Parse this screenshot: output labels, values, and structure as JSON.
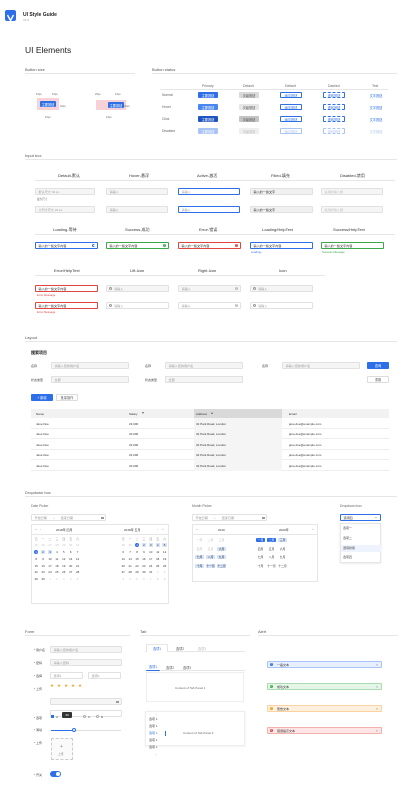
{
  "header": {
    "title": "UI Style Guide",
    "version": "V1.0",
    "page_title": "UI Elements"
  },
  "buttons": {
    "size_title": "Button size",
    "status_title": "Button status",
    "size_annotations": [
      "16px",
      "32px",
      "16px",
      "16px",
      "20px",
      "32px",
      "16px",
      "16px"
    ],
    "size_btn_labels": [
      "主要按钮",
      "主要按钮"
    ],
    "columns": [
      "Primary",
      "Default",
      "Default",
      "Dashed",
      "Text"
    ],
    "rows": [
      "Normal",
      "Hover",
      "Click",
      "Disabled"
    ],
    "primary_label": "主要按钮",
    "default_label": "次级按钮",
    "outline_label": "幽灵按钮",
    "dashed_label": "虚线按钮",
    "text_label": "文字按钮"
  },
  "inputs": {
    "title": "Input box",
    "heads1": [
      "Default-默认",
      "Hover-悬浮",
      "Active-激活",
      "Filled-填充",
      "Disabled-禁用"
    ],
    "placeholder": "请输入",
    "helper_small": "默认尺寸 32 px",
    "helper_small2": "最大尺寸",
    "size_small": "小尺寸尺寸 24 px",
    "filled_text": "输入的一些文字",
    "disabled_text": "禁用的输入框",
    "heads2": [
      "Loading-等待",
      "Success-成功",
      "Error-错误",
      "Loading/HelpText",
      "Success/HelpText"
    ],
    "typed": "输入的一些文字内容",
    "loading_help": "Loading...",
    "success_help": "Success Message",
    "heads3": [
      "Error/HelpText",
      "Lift-Icon",
      "Right-Icon",
      "Icon"
    ],
    "error_msg": "Error Message",
    "icon_placeholder": "请输入"
  },
  "layout": {
    "title": "Layout",
    "form_title": "搜索项目",
    "labels": [
      "名称",
      "名称",
      "名称",
      "状态类型",
      "状态类型"
    ],
    "placeholders": [
      "请输入您的用户名",
      "请输入您的用户名",
      "请输入您的用户名"
    ],
    "select_value": "全部",
    "search_btn": "查询",
    "reset_btn": "重置",
    "add_btn": "+ 新增",
    "batch_btn": "批量操作",
    "table_headers": [
      "Name",
      "Salary",
      "Address",
      "Email"
    ],
    "table_rows": [
      [
        "Jane Doe",
        "23,000",
        "32 Park Road, London",
        "jane.doe@example.com"
      ],
      [
        "Jane Doe",
        "23,000",
        "32 Park Road, London",
        "jane.doe@example.com"
      ],
      [
        "Jane Doe",
        "23,000",
        "32 Park Road, London",
        "jane.doe@example.com"
      ],
      [
        "Jane Doe",
        "23,000",
        "32 Park Road, London",
        "jane.doe@example.com"
      ],
      [
        "Jane Doe",
        "23,000",
        "32 Park Road, London",
        "jane.doe@example.com"
      ]
    ]
  },
  "dropdown": {
    "title": "Dropdown box",
    "date_label": "Date Picker",
    "month_label": "Month Picker",
    "dropdown_label": "Dropdown box",
    "start_ph": "开始日期",
    "end_ph": "结束日期",
    "cal_left_title": "2018年 四月",
    "cal_right_title": "2018年 五月",
    "week": [
      "日",
      "一",
      "二",
      "三",
      "四",
      "五",
      "六"
    ],
    "year_left": "2019",
    "year_right": "2020年",
    "months": [
      "一月",
      "二月",
      "三月",
      "四月",
      "五月",
      "六月",
      "七月",
      "八月",
      "九月",
      "十月",
      "十一月",
      "十二月"
    ],
    "dd_value": "选项四",
    "dd_options": [
      "选项一",
      "选项二",
      "選項狀態",
      "选项四"
    ]
  },
  "form": {
    "title": "Form",
    "labels": [
      "* 用户名",
      "* 密码",
      "* 选择",
      "* 上传",
      "",
      "",
      "* 选项",
      "* 单选",
      "* 滑动",
      "* 上传",
      "* 开关"
    ],
    "username_ph": "请输入您的用户名",
    "password_ph": "请输入密码",
    "select_ph": "选项1",
    "select_ph2": "选项2",
    "checks": [
      "A",
      "B",
      "C",
      "D"
    ],
    "slider_tip": "30",
    "upload_label": "上传"
  },
  "tab": {
    "title": "Tab",
    "tabs1": [
      "选项1",
      "选项2",
      "选项3"
    ],
    "tabs2": [
      "选项1",
      "选项2",
      "选项3"
    ],
    "content1": "Content of Tab Panel 1",
    "content2": "Content of Tab Panel 3",
    "vtabs": [
      "选项 1",
      "选项 1",
      "选项 1",
      "选项 1",
      "选项 1"
    ]
  },
  "alert": {
    "title": "Alert",
    "items": [
      "一般文本",
      "成功文本",
      "警告文本",
      "错误提示文本"
    ],
    "colors": [
      "#2d6fe8",
      "#3aa84a",
      "#f59a23",
      "#e0443e"
    ],
    "bgs": [
      "#e7efff",
      "#e5f5e7",
      "#fdf0df",
      "#fde6e5"
    ]
  }
}
